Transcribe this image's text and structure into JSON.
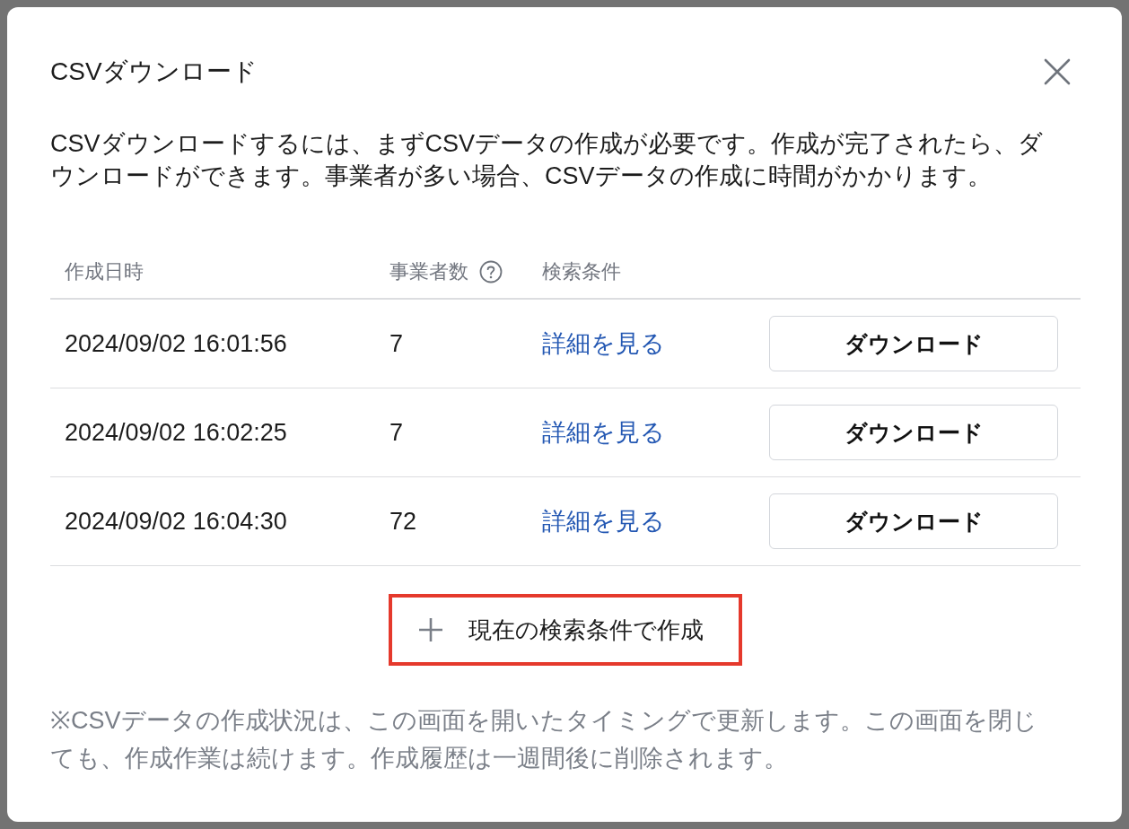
{
  "dialog": {
    "title": "CSVダウンロード",
    "description": "CSVダウンロードするには、まずCSVデータの作成が必要です。作成が完了されたら、ダウンロードができます。事業者が多い場合、CSVデータの作成に時間がかかります。"
  },
  "table": {
    "columns": [
      {
        "label": "作成日時",
        "help": false
      },
      {
        "label": "事業者数",
        "help": true
      },
      {
        "label": "検索条件",
        "help": false
      }
    ],
    "rows": [
      {
        "created_at": "2024/09/02 16:01:56",
        "count": "7",
        "link": "詳細を見る",
        "button": "ダウンロード"
      },
      {
        "created_at": "2024/09/02 16:02:25",
        "count": "7",
        "link": "詳細を見る",
        "button": "ダウンロード"
      },
      {
        "created_at": "2024/09/02 16:04:30",
        "count": "72",
        "link": "詳細を見る",
        "button": "ダウンロード"
      }
    ]
  },
  "create_button": {
    "label": "現在の検索条件で作成",
    "highlighted": true
  },
  "note": "※CSVデータの作成状況は、この画面を開いたタイミングで更新します。この画面を閉じても、作成作業は続けます。作成履歴は一週間後に削除されます。"
}
